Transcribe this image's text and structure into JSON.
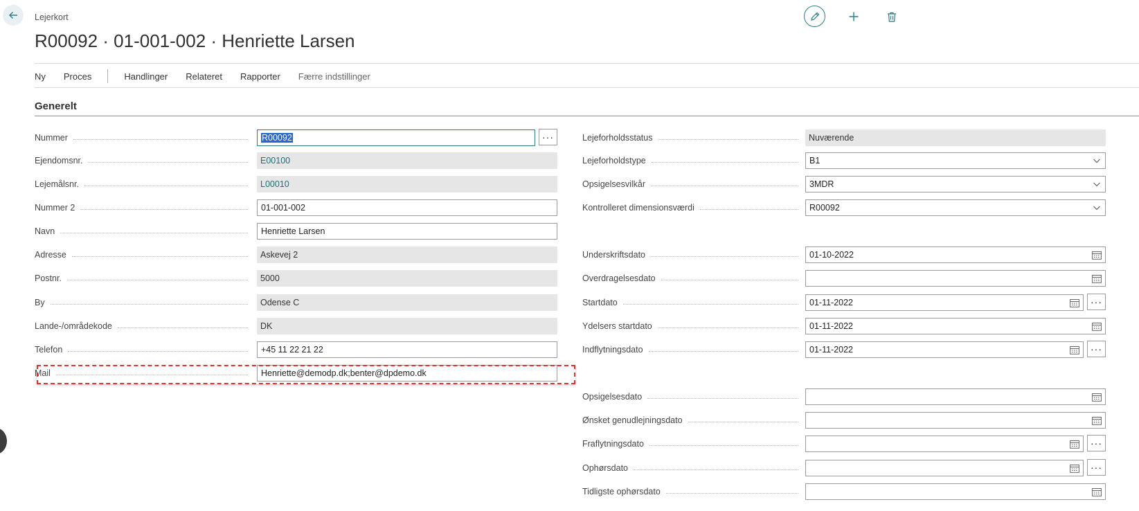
{
  "header": {
    "caption": "Lejerkort",
    "title": "R00092 · 01-001-002 · Henriette Larsen"
  },
  "icons": {
    "back": "back-arrow-icon",
    "edit": "pencil-icon",
    "add": "plus-icon",
    "delete": "trash-icon"
  },
  "actionbar": {
    "items": [
      "Ny",
      "Proces",
      "Handlinger",
      "Relateret",
      "Rapporter",
      "Færre indstillinger"
    ]
  },
  "section": {
    "title": "Generelt"
  },
  "left_fields": [
    {
      "label": "Nummer",
      "value": "R00092"
    },
    {
      "label": "Ejendomsnr.",
      "value": "E00100"
    },
    {
      "label": "Lejemålsnr.",
      "value": "L00010"
    },
    {
      "label": "Nummer 2",
      "value": "01-001-002"
    },
    {
      "label": "Navn",
      "value": "Henriette Larsen"
    },
    {
      "label": "Adresse",
      "value": "Askevej 2"
    },
    {
      "label": "Postnr.",
      "value": "5000"
    },
    {
      "label": "By",
      "value": "Odense C"
    },
    {
      "label": "Lande-/områdekode",
      "value": "DK"
    },
    {
      "label": "Telefon",
      "value": "+45 11 22 21 22"
    },
    {
      "label": "Mail",
      "value": "Henriette@demodp.dk;benter@dpdemo.dk"
    }
  ],
  "right_fields": [
    {
      "label": "Lejeforholdsstatus",
      "value": "Nuværende"
    },
    {
      "label": "Lejeforholdstype",
      "value": "B1"
    },
    {
      "label": "Opsigelsesvilkår",
      "value": "3MDR"
    },
    {
      "label": "Kontrolleret dimensionsværdi",
      "value": "R00092"
    },
    {
      "label": "Underskriftsdato",
      "value": "01-10-2022"
    },
    {
      "label": "Overdragelsesdato",
      "value": ""
    },
    {
      "label": "Startdato",
      "value": "01-11-2022"
    },
    {
      "label": "Ydelsers startdato",
      "value": "01-11-2022"
    },
    {
      "label": "Indflytningsdato",
      "value": "01-11-2022"
    },
    {
      "label": "Opsigelsesdato",
      "value": ""
    },
    {
      "label": "Ønsket genudlejningsdato",
      "value": ""
    },
    {
      "label": "Fraflytningsdato",
      "value": ""
    },
    {
      "label": "Ophørsdato",
      "value": ""
    },
    {
      "label": "Tidligste ophørsdato",
      "value": ""
    }
  ],
  "colors": {
    "accent": "#2c7c86",
    "highlight": "#e03030",
    "readonly_bg": "#e6e6e6",
    "selection": "#2a67c9"
  }
}
